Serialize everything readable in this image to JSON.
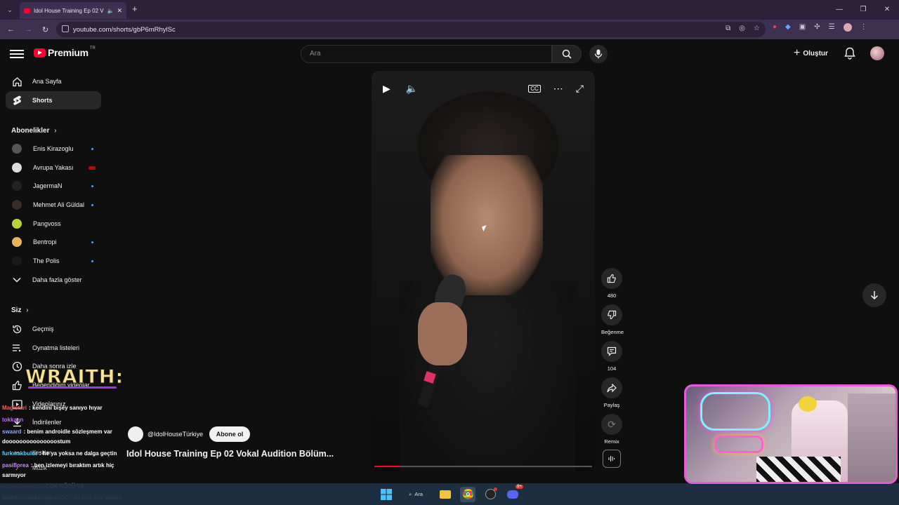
{
  "browser": {
    "tab_title": "Idol House Training Ep 02 V",
    "url": "youtube.com/shorts/gbP6mRhylSc"
  },
  "header": {
    "logo_text": "Premium",
    "region": "TR",
    "search_placeholder": "Ara",
    "create_label": "Oluştur"
  },
  "sidebar": {
    "home": "Ana Sayfa",
    "shorts": "Shorts",
    "subs_title": "Abonelikler",
    "subscriptions": [
      {
        "name": "Enis Kirazoglu",
        "color": "#555555"
      },
      {
        "name": "Avrupa Yakası",
        "color": "#dddddd"
      },
      {
        "name": "JagermaN",
        "color": "#222222"
      },
      {
        "name": "Mehmet Ali Güldal",
        "color": "#3a2e28"
      },
      {
        "name": "Pangvoss",
        "color": "#b6d43a"
      },
      {
        "name": "Bentropi",
        "color": "#e8b35a"
      },
      {
        "name": "The Polis",
        "color": "#1a1a1a"
      }
    ],
    "show_more": "Daha fazla göster",
    "you_title": "Siz",
    "history": "Geçmiş",
    "playlists": "Oynatma listeleri",
    "watch_later": "Daha sonra izle",
    "liked": "Beğendiğim videolar",
    "videos": "Videolarınız",
    "downloads": "İndirilenler",
    "clips": "Kesitler",
    "music": "Müzik"
  },
  "short": {
    "likes": "480",
    "dislike_label": "Beğenme",
    "comments": "104",
    "share_label": "Paylaş",
    "remix_label": "Remix",
    "channel": "@IdolHouseTürkiye",
    "subscribe_label": "Abone ol",
    "title": "Idol House Training Ep 02 Vokal Audition Bölüm...",
    "progress": 0.12
  },
  "overlay": {
    "wraith": "WRAITH:"
  },
  "chat": [
    {
      "user": "Magistari",
      "text": ": kendini bişey sanıyo hıyar",
      "color": "#ff5b5b"
    },
    {
      "user": "tokkaan",
      "text": "",
      "color": "#c266ff"
    },
    {
      "user": "swaard",
      "text": ": benim androidle sözleşmem var",
      "color": "#8aa8ff"
    },
    {
      "user": "",
      "text": "dooooooooooooooostum",
      "color": "#ffffff"
    },
    {
      "user": "furkwakbulut",
      "text": ": he ya yoksa ne dalga geçtin",
      "color": "#5fd0ff"
    },
    {
      "user": "pasiflorea",
      "text": ": ben izlemeyi bıraktım artık hiç",
      "color": "#c78cff"
    },
    {
      "user": "",
      "text": "sarmıyor",
      "color": "#ffffff"
    },
    {
      "user": "umentenfekas",
      "text": ": ÇOK KÖTÜ YA",
      "color": "#ff4a7a"
    },
    {
      "user": "BelisinDudakDolgusuCC",
      "text": ": aa türk buz pateni",
      "color": "#ffffff"
    }
  ],
  "taskbar": {
    "search_label": "Ara",
    "discord_badge": "9+"
  }
}
